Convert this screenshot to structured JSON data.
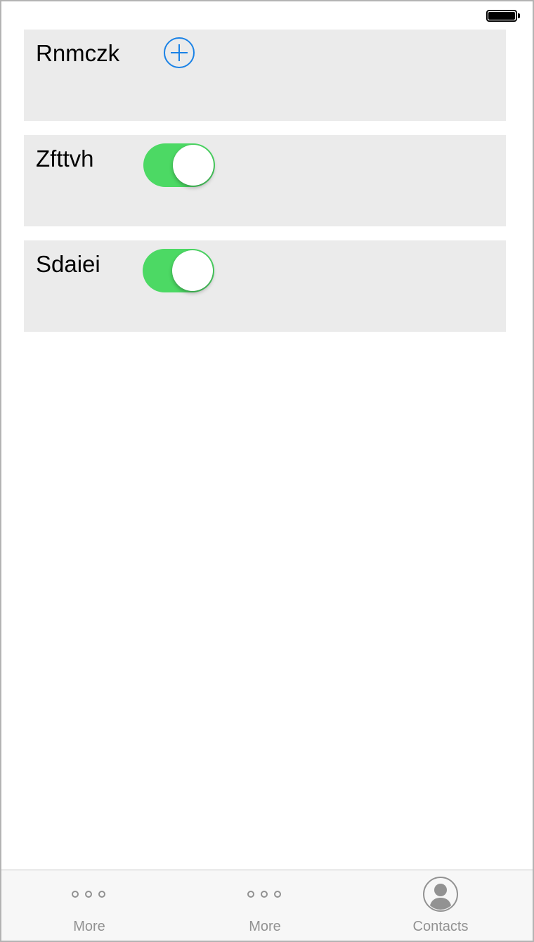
{
  "status_bar": {
    "battery_icon": "battery-full-icon",
    "battery_level": 1.0
  },
  "rows": [
    {
      "label": "Rnmczk",
      "control": "add-button",
      "icon": "plus-circle-icon",
      "accent_color": "#1a82e6"
    },
    {
      "label": "Zfttvh",
      "control": "toggle",
      "on": true,
      "accent_color": "#4cd964"
    },
    {
      "label": "Sdaiei",
      "control": "toggle",
      "on": true,
      "accent_color": "#4cd964"
    }
  ],
  "tab_bar": {
    "tabs": [
      {
        "label": "More",
        "icon": "more-icon"
      },
      {
        "label": "More",
        "icon": "more-icon"
      },
      {
        "label": "Contacts",
        "icon": "contacts-icon"
      }
    ],
    "inactive_color": "#929292"
  }
}
